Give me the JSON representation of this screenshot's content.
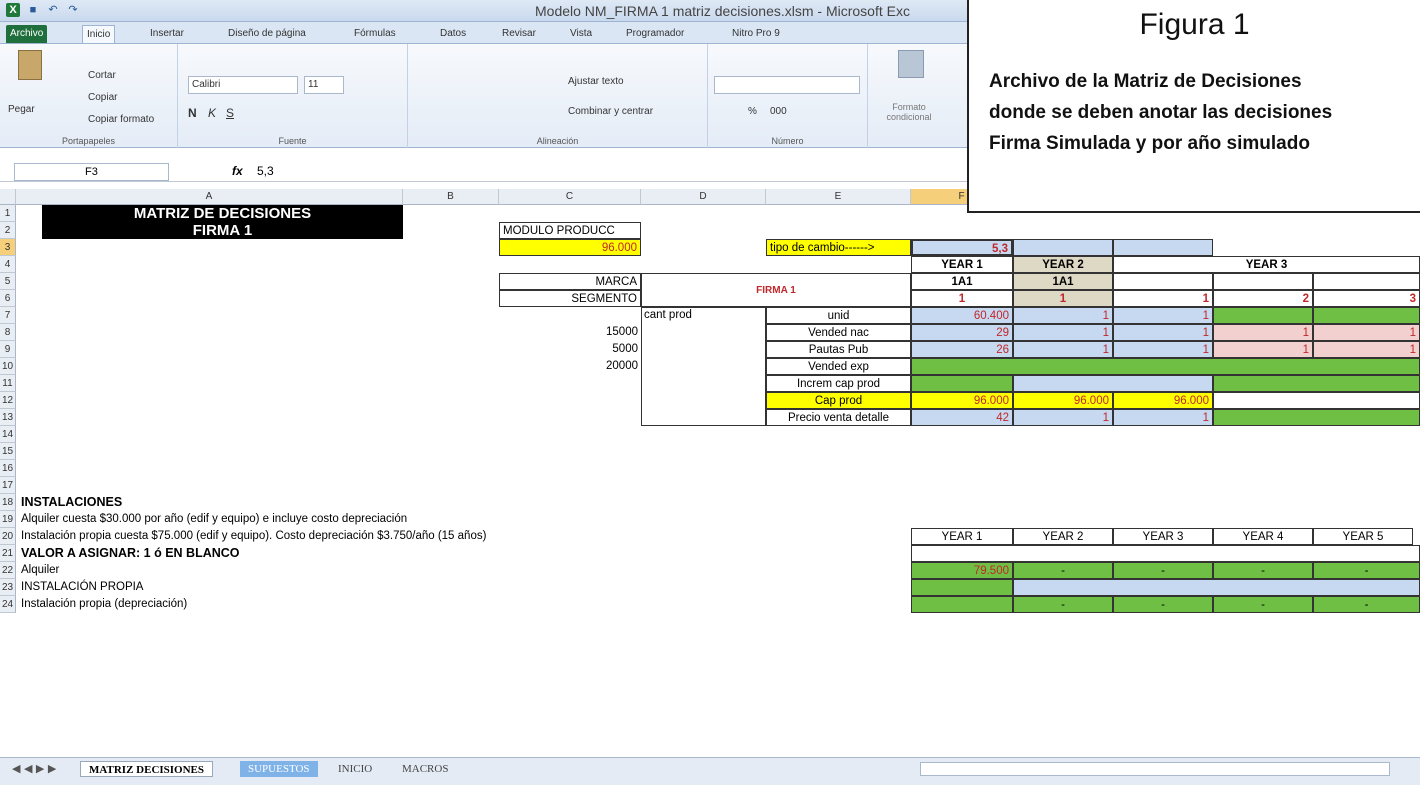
{
  "window": {
    "title": "Modelo NM_FIRMA 1 matriz decisiones.xlsm - Microsoft Exc"
  },
  "ribbon_tabs": [
    "Archivo",
    "Inicio",
    "Insertar",
    "Diseño de página",
    "Fórmulas",
    "Datos",
    "Revisar",
    "Vista",
    "Programador",
    "Nitro Pro 9"
  ],
  "ribbon": {
    "paste": "Pegar",
    "cut": "Cortar",
    "copy": "Copiar",
    "format_painter": "Copiar formato",
    "clipboard": "Portapapeles",
    "font_name": "Calibri",
    "font_size": "11",
    "font_group": "Fuente",
    "wrap_text": "Ajustar texto",
    "merge_center": "Combinar y centrar",
    "alignment_group": "Alineación",
    "number_group": "Número",
    "conditional_format": "Formato condicional",
    "number_format_pct": "%",
    "number_format_thousands": "000"
  },
  "formula_bar": {
    "cell_ref": "F3",
    "fx": "fx",
    "value": "5,3"
  },
  "columns": [
    "A",
    "B",
    "C",
    "D",
    "E",
    "F"
  ],
  "rows": [
    "1",
    "2",
    "3",
    "4",
    "5",
    "6",
    "7",
    "8",
    "9",
    "10",
    "11",
    "12",
    "13",
    "14",
    "15",
    "16",
    "17",
    "18",
    "19",
    "20",
    "21",
    "22",
    "23",
    "24"
  ],
  "cells": {
    "title1": "MATRIZ DE DECISIONES",
    "title2": "FIRMA 1",
    "modulo_label": "MODULO PRODUCC",
    "modulo_value": "96.000",
    "tipo_cambio_label": "tipo de cambio------>",
    "tipo_cambio_value": "5,3",
    "year1": "YEAR 1",
    "year2": "YEAR 2",
    "year3": "YEAR 3",
    "marca": "MARCA",
    "segmento": "SEGMENTO",
    "firma": "FIRMA 1",
    "brand1": "1A1",
    "brand2": "1A1",
    "seg1": "1",
    "seg2": "1",
    "seg3": "1",
    "seg4": "2",
    "seg5": "3",
    "cant_prod": "cant prod",
    "d8": "15000",
    "d9": "5000",
    "d10": "20000",
    "unid": "unid",
    "vended_nac": "Vended nac",
    "pautas_pub": "Pautas Pub",
    "vended_exp": "Vended exp",
    "increm_cap": "Increm cap prod",
    "cap_prod": "Cap prod",
    "precio": "Precio venta detalle",
    "unid_v1": "60.400",
    "unid_v2": "1",
    "unid_v3": "1",
    "vn_v1": "29",
    "vn_v2": "1",
    "vn_v3": "1",
    "vn_v4": "1",
    "vn_v5": "1",
    "pp_v1": "26",
    "pp_v2": "1",
    "pp_v3": "1",
    "pp_v4": "1",
    "pp_v5": "1",
    "cap_v1": "96.000",
    "cap_v2": "96.000",
    "cap_v3": "96.000",
    "precio_v1": "42",
    "precio_v2": "1",
    "precio_v3": "1",
    "instalaciones": "INSTALACIONES",
    "alquiler_note": "Alquiler cuesta $30.000 por año (edif y equipo) e incluye costo depreciación",
    "propia_note": "Instalación propia cuesta $75.000 (edif y equipo). Costo depreciación $3.750/año (15 años)",
    "valor_asignar": "VALOR A ASIGNAR: 1 ó EN BLANCO",
    "alquiler": "Alquiler",
    "inst_propia": "INSTALACIÓN PROPIA",
    "inst_dep": "Instalación propia (depreciación)",
    "y20_1": "YEAR 1",
    "y20_2": "YEAR 2",
    "y20_3": "YEAR 3",
    "y20_4": "YEAR 4",
    "y20_5": "YEAR 5",
    "alq_v1": "79.500",
    "dash": "-"
  },
  "sheet_tabs": [
    "MATRIZ DECISIONES",
    "SUPUESTOS",
    "INICIO",
    "MACROS"
  ],
  "callout": {
    "title": "Figura 1",
    "text": "Archivo de la Matriz de Decisiones\ndonde se deben anotar las decisiones\nFirma Simulada y por año simulado"
  }
}
